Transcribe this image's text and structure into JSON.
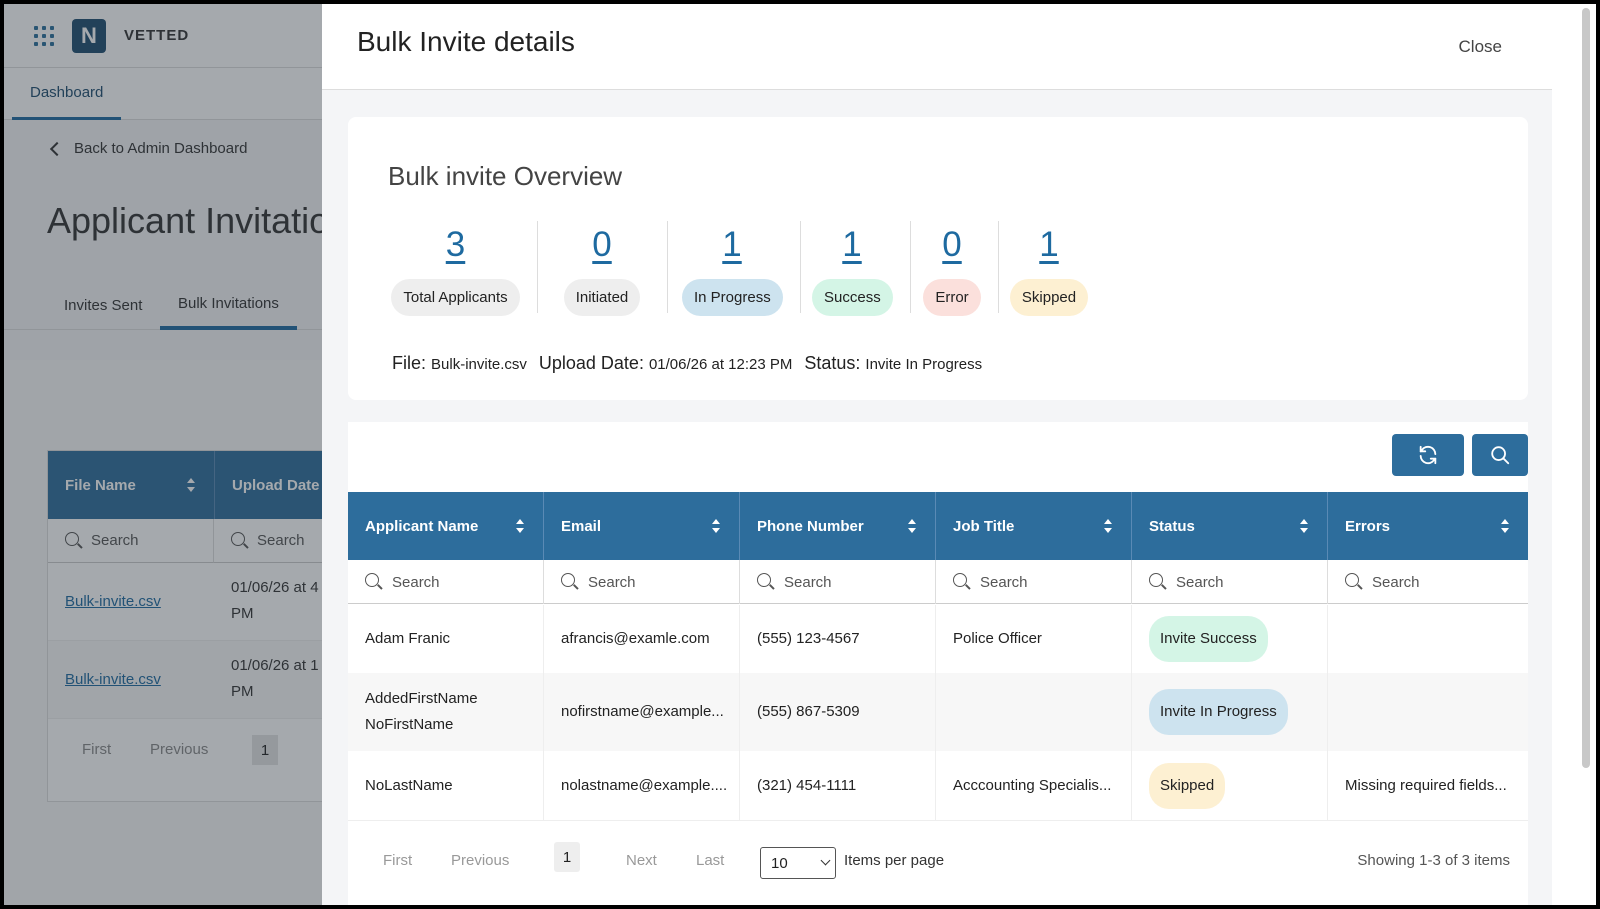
{
  "app": {
    "brand": "VETTED",
    "logo_letter": "N",
    "nav_tab": "Dashboard",
    "back_link": "Back to Admin Dashboard",
    "page_title": "Applicant Invitations",
    "tabs": [
      "Invites Sent",
      "Bulk Invitations"
    ],
    "table": {
      "headers": [
        "File Name",
        "Upload Date"
      ],
      "search_placeholder": "Search",
      "rows": [
        {
          "file": "Bulk-invite.csv",
          "date_line1": "01/06/26 at 4",
          "date_line2": "PM"
        },
        {
          "file": "Bulk-invite.csv",
          "date_line1": "01/06/26 at 1",
          "date_line2": "PM"
        }
      ],
      "pager": {
        "first": "First",
        "previous": "Previous",
        "page": "1"
      }
    }
  },
  "drawer": {
    "title": "Bulk Invite details",
    "close": "Close",
    "overview": {
      "title": "Bulk invite Overview",
      "stats": [
        {
          "value": "3",
          "label": "Total Applicants",
          "color": "#eeeeee"
        },
        {
          "value": "0",
          "label": "Initiated",
          "color": "#eeeeee"
        },
        {
          "value": "1",
          "label": "In Progress",
          "color": "#cde3ef"
        },
        {
          "value": "1",
          "label": "Success",
          "color": "#d4f5e6"
        },
        {
          "value": "0",
          "label": "Error",
          "color": "#fbe0dc"
        },
        {
          "value": "1",
          "label": "Skipped",
          "color": "#fdf0d2"
        }
      ],
      "file_label": "File:",
      "file_value": "Bulk-invite.csv",
      "upload_label": "Upload Date:",
      "upload_value": "01/06/26 at 12:23 PM",
      "status_label": "Status:",
      "status_value": "Invite In Progress"
    },
    "table": {
      "columns": [
        "Applicant Name",
        "Email",
        "Phone Number",
        "Job Title",
        "Status",
        "Errors"
      ],
      "search_placeholder": "Search",
      "rows": [
        {
          "name": "Adam Franic",
          "email": "afrancis@examle.com",
          "phone": "(555) 123-4567",
          "job": "Police Officer",
          "status": "Invite Success",
          "status_color": "#d4f5e6",
          "errors": ""
        },
        {
          "name": "AddedFirstName NoFirstName",
          "email": "nofirstname@example...",
          "phone": "(555) 867-5309",
          "job": "",
          "status": "Invite In Progress",
          "status_color": "#cde3ef",
          "errors": ""
        },
        {
          "name": "NoLastName",
          "email": "nolastname@example....",
          "phone": "(321) 454-1111",
          "job": "Acccounting Specialis...",
          "status": "Skipped",
          "status_color": "#fdf0d2",
          "errors": "Missing required fields..."
        }
      ],
      "pager": {
        "first": "First",
        "previous": "Previous",
        "page": "1",
        "next": "Next",
        "last": "Last",
        "items_per_page_value": "10",
        "items_per_page_label": "Items per page",
        "showing": "Showing 1-3 of 3 items"
      }
    }
  },
  "icons": [
    "apps-grid-icon",
    "chevron-left-icon",
    "refresh-icon",
    "search-icon",
    "sort-icon",
    "chevron-down-icon"
  ]
}
